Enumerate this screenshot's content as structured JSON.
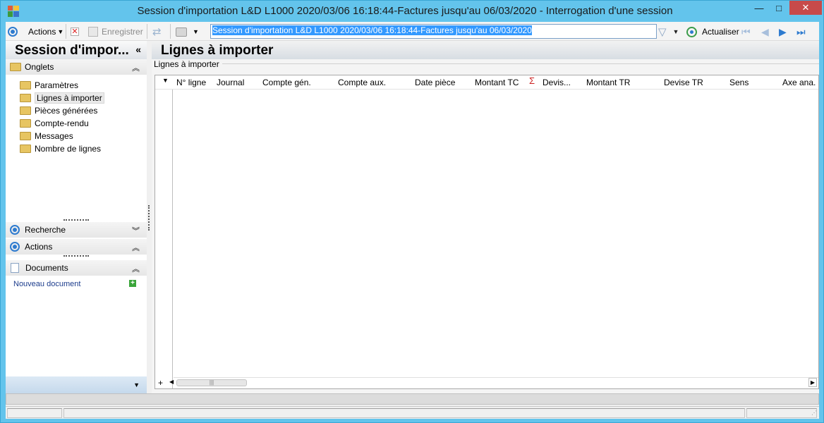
{
  "window": {
    "title": "Session d'importation L&D L1000 2020/03/06 16:18:44-Factures jusqu'au 06/03/2020 -  Interrogation d'une session",
    "minimize": "—",
    "maximize": "□",
    "close": "✕"
  },
  "toolbar": {
    "actions_label": "Actions",
    "save_label": "Enregistrer",
    "nav_value": "Session d'importation L&D L1000 2020/03/06 16:18:44-Factures jusqu'au 06/03/2020",
    "refresh_label": "Actualiser"
  },
  "left_panel": {
    "title": "Session d'impor...",
    "tabs_section": "Onglets",
    "items": [
      "Paramètres",
      "Lignes à importer",
      "Pièces générées",
      "Compte-rendu",
      "Messages",
      "Nombre de lignes"
    ],
    "selected_index": 1,
    "search_section": "Recherche",
    "actions_section": "Actions",
    "documents_section": "Documents",
    "new_document": "Nouveau document"
  },
  "main": {
    "title": "Lignes à importer",
    "group_label": "Lignes à importer",
    "columns": [
      "N° ligne",
      "Journal",
      "Compte gén.",
      "Compte aux.",
      "Date pièce",
      "Montant TC",
      "Devis...",
      "Montant TR",
      "Devise TR",
      "Sens",
      "Axe ana."
    ],
    "sigma": "Σ"
  },
  "colors": {
    "frame": "#63c4ec",
    "accent": "#2e7bcf",
    "close": "#c74a4a"
  }
}
